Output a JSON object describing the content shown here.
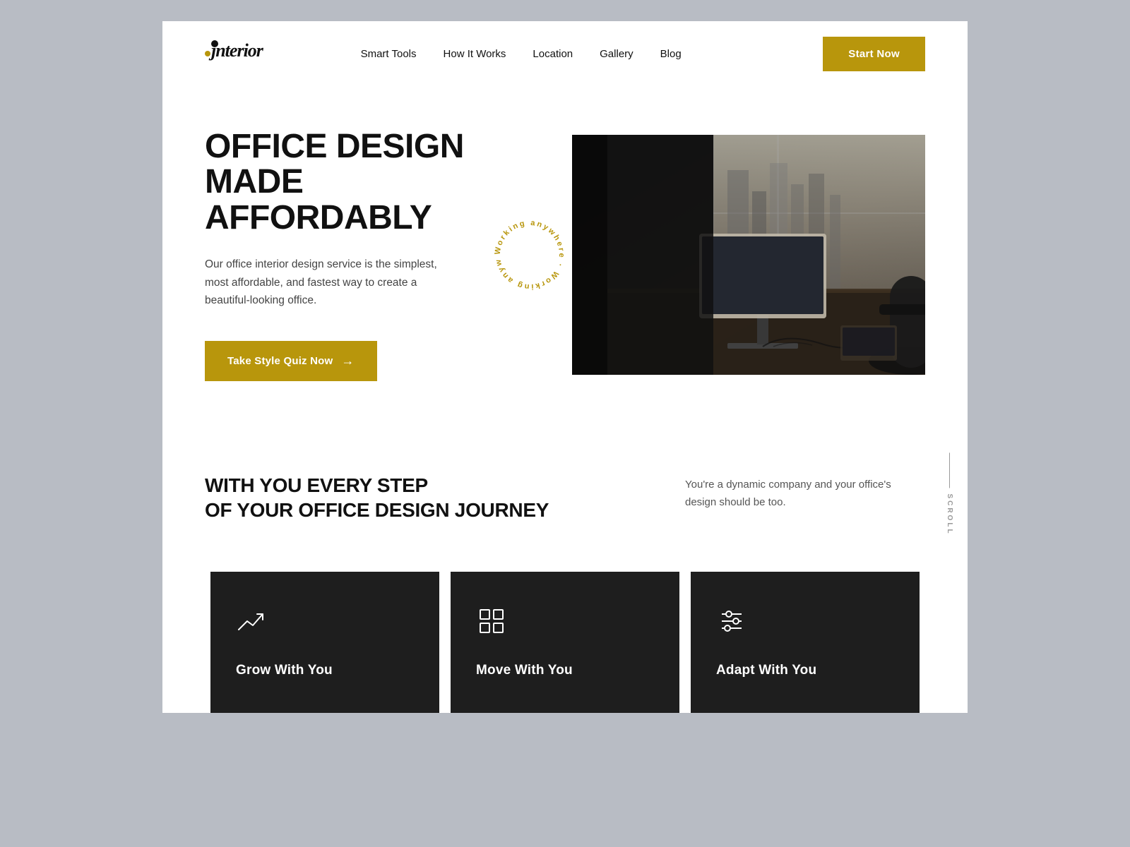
{
  "logo": {
    "text": "jnterior"
  },
  "nav": {
    "items": [
      {
        "label": "Smart Tools",
        "id": "smart-tools"
      },
      {
        "label": "How It Works",
        "id": "how-it-works"
      },
      {
        "label": "Location",
        "id": "location"
      },
      {
        "label": "Gallery",
        "id": "gallery"
      },
      {
        "label": "Blog",
        "id": "blog"
      }
    ],
    "cta_label": "Start Now"
  },
  "hero": {
    "title_line1": "OFFICE DESIGN",
    "title_line2": "MADE AFFORDABLY",
    "description": "Our office interior design service is the simplest, most affordable, and fastest way to create a beautiful-looking office.",
    "cta_label": "Take Style Quiz Now",
    "circular_text": "Working anywhere · Working anywhere ·"
  },
  "mid": {
    "title_line1": "WITH YOU EVERY STEP",
    "title_line2": "OF YOUR OFFICE DESIGN JOURNEY",
    "description": "You're a dynamic company and your office's design should be too.",
    "scroll_label": "SCROLL"
  },
  "cards": [
    {
      "icon": "trend-up",
      "title": "Grow with you"
    },
    {
      "icon": "grid",
      "title": "Move with you"
    },
    {
      "icon": "sliders",
      "title": "Adapt with you"
    }
  ],
  "colors": {
    "accent": "#b8960c",
    "dark": "#1e1e1e",
    "text_primary": "#111111",
    "text_secondary": "#555555"
  }
}
